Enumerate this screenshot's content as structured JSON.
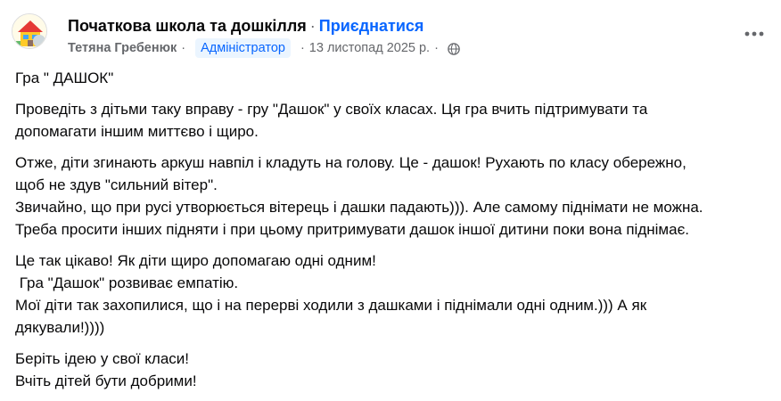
{
  "header": {
    "group_name": "Початкова школа та дошкілля",
    "separator": "·",
    "join_label": "Приєднатися",
    "author": "Тетяна Гребенюк",
    "author_separator": "·",
    "role_badge": "Адміністратор",
    "date_separator": "·",
    "date": "13 листопад 2025 р.",
    "privacy_separator": "·",
    "privacy_icon": "globe-icon",
    "more_icon": "more-horizontal-icon"
  },
  "post": {
    "title": "Гра \" ДАШОК\"",
    "p1": [
      "Проведіть з дітьми таку вправу - гру \"Дашок\" у своїх класах. Ця гра вчить підтримувати та",
      "допомагати іншим миттєво і щиро."
    ],
    "p2": [
      "Отже, діти згинають аркуш навпіл і кладуть на голову. Це - дашок! Рухають по класу обережно,",
      "щоб не здув \"сильний вітер\".",
      "Звичайно, що при русі утворюється вітерець і дашки падають))). Але самому піднімати не можна.",
      "Треба просити інших підняти і при цьому притримувати дашок іншої дитини поки вона піднімає."
    ],
    "p3": [
      "Це так цікаво! Як діти щиро допомагаю одні одним!",
      " Гра \"Дашок\" розвиває емпатію.",
      "Мої діти так захопилися, що і на перерві ходили з дашками і піднімали одні одним.))) А як",
      "дякували!))))"
    ],
    "p4": [
      "Беріть ідею у свої класи!",
      "Вчіть дітей бути добрими!"
    ]
  },
  "colors": {
    "accent": "#0866ff",
    "meta": "#65676b",
    "badge_bg": "#ebf5ff",
    "text": "#080809"
  }
}
